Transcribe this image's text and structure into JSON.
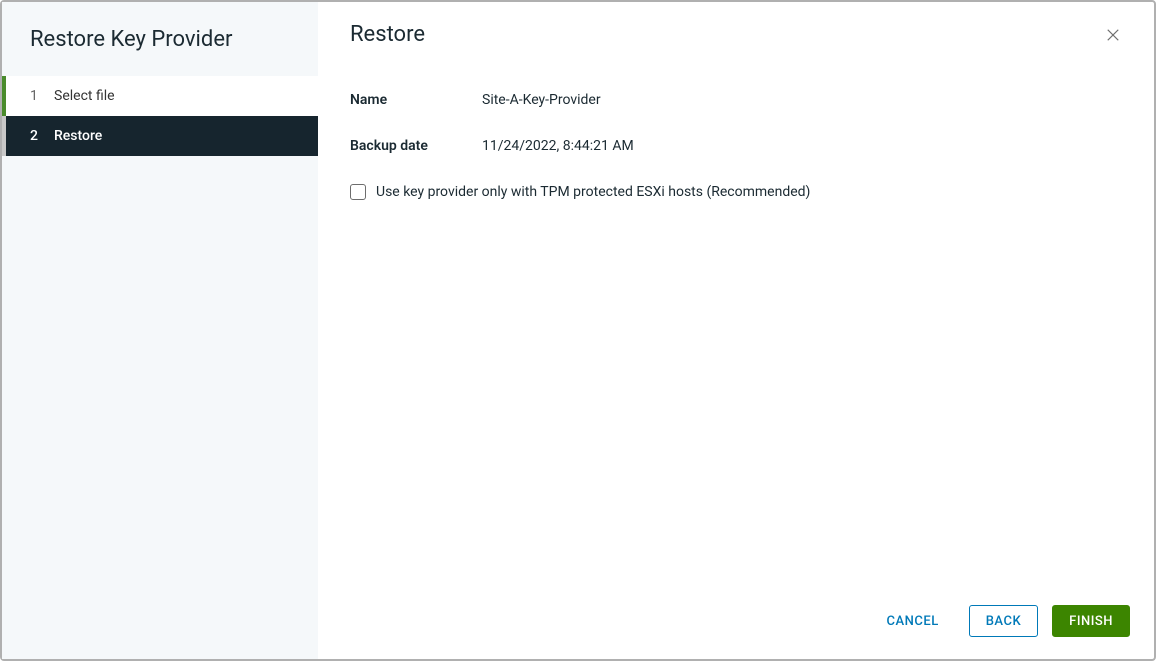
{
  "wizard": {
    "title": "Restore Key Provider",
    "steps": [
      {
        "num": "1",
        "label": "Select file"
      },
      {
        "num": "2",
        "label": "Restore"
      }
    ]
  },
  "content": {
    "title": "Restore",
    "name_label": "Name",
    "name_value": "Site-A-Key-Provider",
    "backup_date_label": "Backup date",
    "backup_date_value": "11/24/2022, 8:44:21 AM",
    "tpm_checkbox_label": "Use key provider only with TPM protected ESXi hosts (Recommended)"
  },
  "footer": {
    "cancel": "CANCEL",
    "back": "BACK",
    "finish": "FINISH"
  }
}
